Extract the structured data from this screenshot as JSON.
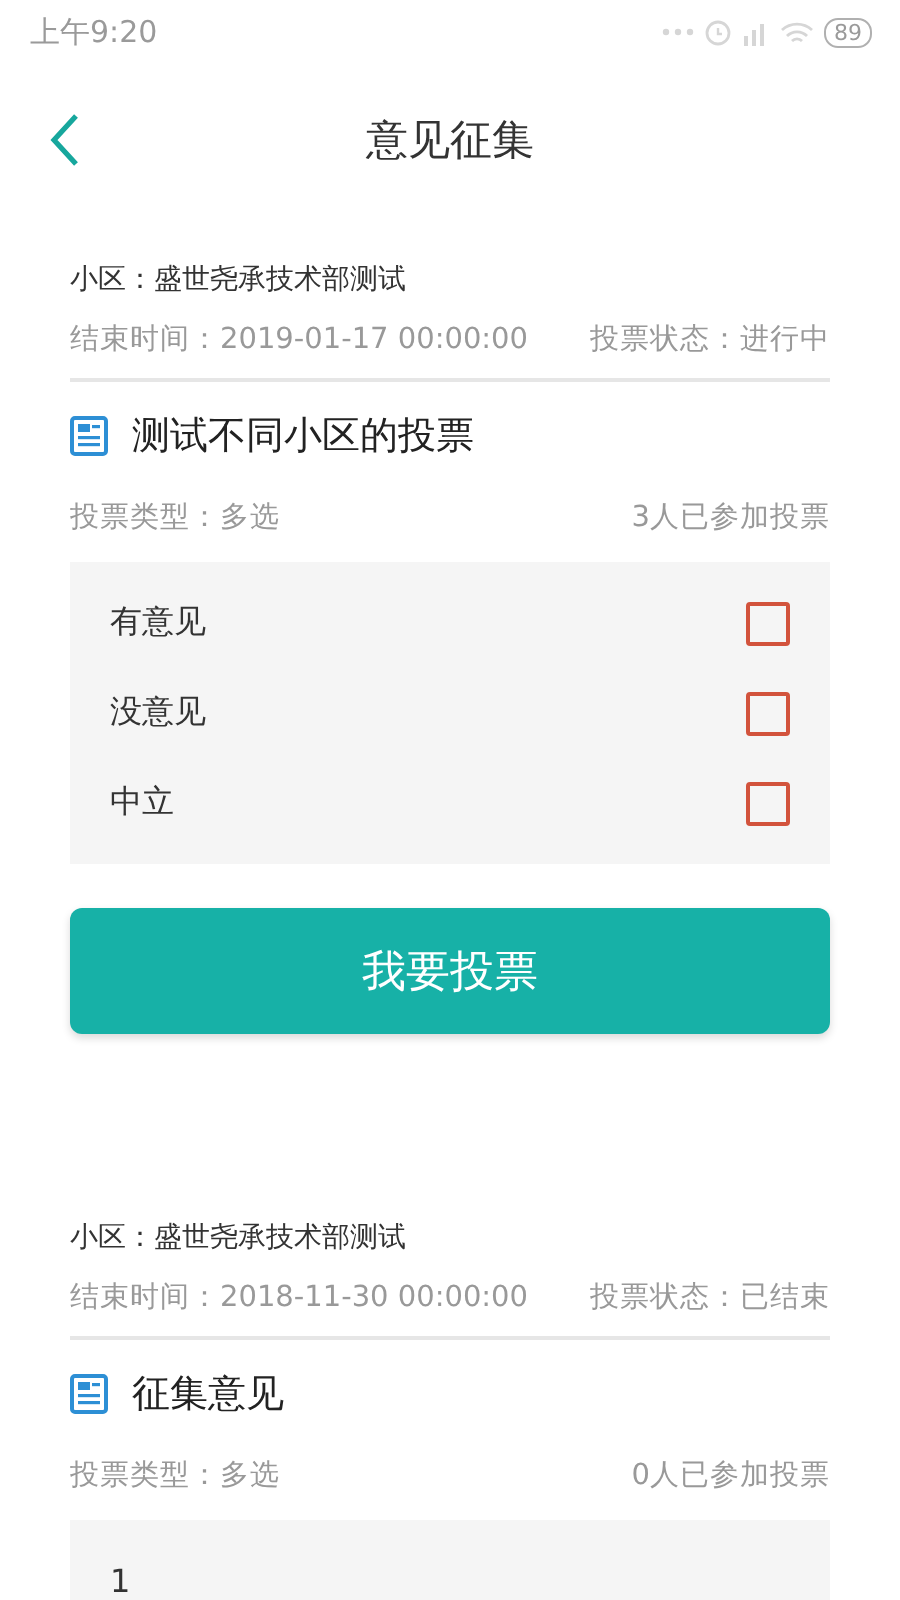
{
  "status_bar": {
    "time": "上午9:20",
    "battery": "89"
  },
  "header": {
    "title": "意见征集"
  },
  "polls": [
    {
      "community": "小区：盛世尧承技术部测试",
      "end_time": "结束时间：2019-01-17 00:00:00",
      "status": "投票状态：进行中",
      "title": "测试不同小区的投票",
      "vote_type": "投票类型：多选",
      "participants": "3人已参加投票",
      "options": [
        {
          "label": "有意见",
          "checked": false
        },
        {
          "label": "没意见",
          "checked": false
        },
        {
          "label": "中立",
          "checked": false
        }
      ],
      "button": "我要投票"
    },
    {
      "community": "小区：盛世尧承技术部测试",
      "end_time": "结束时间：2018-11-30 00:00:00",
      "status": "投票状态：已结束",
      "title": "征集意见",
      "vote_type": "投票类型：多选",
      "participants": "0人已参加投票",
      "options": [
        {
          "label": "1"
        }
      ]
    }
  ]
}
